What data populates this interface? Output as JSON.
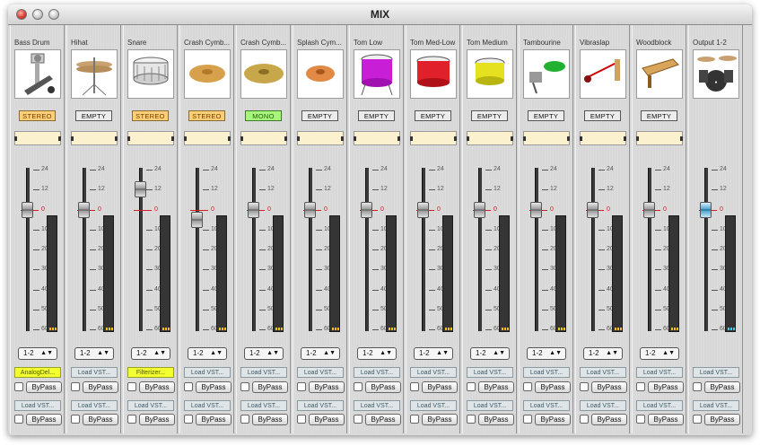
{
  "window": {
    "title": "MIX"
  },
  "channels": [
    {
      "name": "Bass Drum",
      "bus": "STEREO",
      "bus_type": "stereo",
      "fader_db": 0,
      "output": "1-2",
      "slot1": "AnalogDel...",
      "slot1_active": true,
      "slot2": "Load VST...",
      "bypass1": "ByPass",
      "bypass2": "ByPass",
      "icon": "bass-drum-pedal-icon"
    },
    {
      "name": "Hihat",
      "bus": "EMPTY",
      "bus_type": "empty",
      "fader_db": 0,
      "output": "1-2",
      "slot1": "Load VST...",
      "slot1_active": false,
      "slot2": "Load VST...",
      "bypass1": "ByPass",
      "bypass2": "ByPass",
      "icon": "hihat-icon"
    },
    {
      "name": "Snare",
      "bus": "STEREO",
      "bus_type": "stereo",
      "fader_db": 12,
      "output": "1-2",
      "slot1": "Filterizer...",
      "slot1_active": true,
      "slot2": "Load VST...",
      "bypass1": "ByPass",
      "bypass2": "ByPass",
      "icon": "snare-drum-icon"
    },
    {
      "name": "Crash Cymb...",
      "bus": "STEREO",
      "bus_type": "stereo",
      "fader_db": -5,
      "output": "1-2",
      "slot1": "Load VST...",
      "slot1_active": false,
      "slot2": "Load VST...",
      "bypass1": "ByPass",
      "bypass2": "ByPass",
      "icon": "crash-cymbal-icon"
    },
    {
      "name": "Crash Cymb...",
      "bus": "MONO",
      "bus_type": "mono",
      "fader_db": 0,
      "output": "1-2",
      "slot1": "Load VST...",
      "slot1_active": false,
      "slot2": "Load VST...",
      "bypass1": "ByPass",
      "bypass2": "ByPass",
      "icon": "crash-cymbal-2-icon"
    },
    {
      "name": "Splash Cym...",
      "bus": "EMPTY",
      "bus_type": "empty",
      "fader_db": 0,
      "output": "1-2",
      "slot1": "Load VST...",
      "slot1_active": false,
      "slot2": "Load VST...",
      "bypass1": "ByPass",
      "bypass2": "ByPass",
      "icon": "splash-cymbal-icon"
    },
    {
      "name": "Tom Low",
      "bus": "EMPTY",
      "bus_type": "empty",
      "fader_db": 0,
      "output": "1-2",
      "slot1": "Load VST...",
      "slot1_active": false,
      "slot2": "Load VST...",
      "bypass1": "ByPass",
      "bypass2": "ByPass",
      "icon": "tom-low-icon"
    },
    {
      "name": "Tom Med-Low",
      "bus": "EMPTY",
      "bus_type": "empty",
      "fader_db": 0,
      "output": "1-2",
      "slot1": "Load VST...",
      "slot1_active": false,
      "slot2": "Load VST...",
      "bypass1": "ByPass",
      "bypass2": "ByPass",
      "icon": "tom-med-low-icon"
    },
    {
      "name": "Tom Medium",
      "bus": "EMPTY",
      "bus_type": "empty",
      "fader_db": 0,
      "output": "1-2",
      "slot1": "Load VST...",
      "slot1_active": false,
      "slot2": "Load VST...",
      "bypass1": "ByPass",
      "bypass2": "ByPass",
      "icon": "tom-medium-icon"
    },
    {
      "name": "Tambourine",
      "bus": "EMPTY",
      "bus_type": "empty",
      "fader_db": 0,
      "output": "1-2",
      "slot1": "Load VST...",
      "slot1_active": false,
      "slot2": "Load VST...",
      "bypass1": "ByPass",
      "bypass2": "ByPass",
      "icon": "tambourine-icon"
    },
    {
      "name": "Vibraslap",
      "bus": "EMPTY",
      "bus_type": "empty",
      "fader_db": 0,
      "output": "1-2",
      "slot1": "Load VST...",
      "slot1_active": false,
      "slot2": "Load VST...",
      "bypass1": "ByPass",
      "bypass2": "ByPass",
      "icon": "vibraslap-icon"
    },
    {
      "name": "Woodblock",
      "bus": "EMPTY",
      "bus_type": "empty",
      "fader_db": 0,
      "output": "1-2",
      "slot1": "Load VST...",
      "slot1_active": false,
      "slot2": "Load VST...",
      "bypass1": "ByPass",
      "bypass2": "ByPass",
      "icon": "woodblock-icon"
    }
  ],
  "output": {
    "name": "Output 1-2",
    "fader_db": 0,
    "slot1": "Load VST...",
    "slot2": "Load VST...",
    "bypass1": "ByPass",
    "bypass2": "ByPass",
    "icon": "drum-kit-icon"
  },
  "scale": {
    "labels": [
      "24",
      "12",
      "0",
      "10",
      "20",
      "30",
      "40",
      "50",
      "60"
    ]
  },
  "colors": {
    "stereo": "#ffcf78",
    "mono": "#a8f57c",
    "plugin_active": "#f3ff2e",
    "output_knob": "#4ea3cf"
  }
}
